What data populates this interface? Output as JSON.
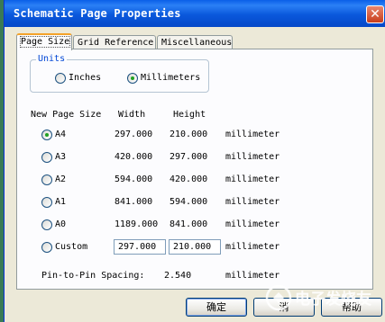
{
  "dialog": {
    "title": "Schematic Page Properties",
    "close_glyph": "✕"
  },
  "tabs": [
    {
      "label": "Page Size",
      "active": true
    },
    {
      "label": "Grid Reference",
      "active": false
    },
    {
      "label": "Miscellaneous",
      "active": false
    }
  ],
  "units": {
    "group_label": "Units",
    "options": [
      {
        "label": "Inches",
        "selected": false
      },
      {
        "label": "Millimeters",
        "selected": true
      }
    ]
  },
  "table": {
    "headers": {
      "size": "New Page Size",
      "width": "Width",
      "height": "Height"
    },
    "rows": [
      {
        "size": "A4",
        "width": "297.000",
        "height": "210.000",
        "unit": "millimeter",
        "selected": true
      },
      {
        "size": "A3",
        "width": "420.000",
        "height": "297.000",
        "unit": "millimeter",
        "selected": false
      },
      {
        "size": "A2",
        "width": "594.000",
        "height": "420.000",
        "unit": "millimeter",
        "selected": false
      },
      {
        "size": "A1",
        "width": "841.000",
        "height": "594.000",
        "unit": "millimeter",
        "selected": false
      },
      {
        "size": "A0",
        "width": "1189.000",
        "height": "841.000",
        "unit": "millimeter",
        "selected": false
      }
    ],
    "custom": {
      "size": "Custom",
      "width": "297.000",
      "height": "210.000",
      "unit": "millimeter",
      "selected": false
    }
  },
  "spacing": {
    "label": "Pin-to-Pin Spacing:",
    "value": "2.540",
    "unit": "millimeter"
  },
  "buttons": {
    "ok": "确定",
    "cancel": "消",
    "help": "帮助"
  },
  "watermark": {
    "text": "电子发烧友",
    "accent": "#ffffff"
  }
}
